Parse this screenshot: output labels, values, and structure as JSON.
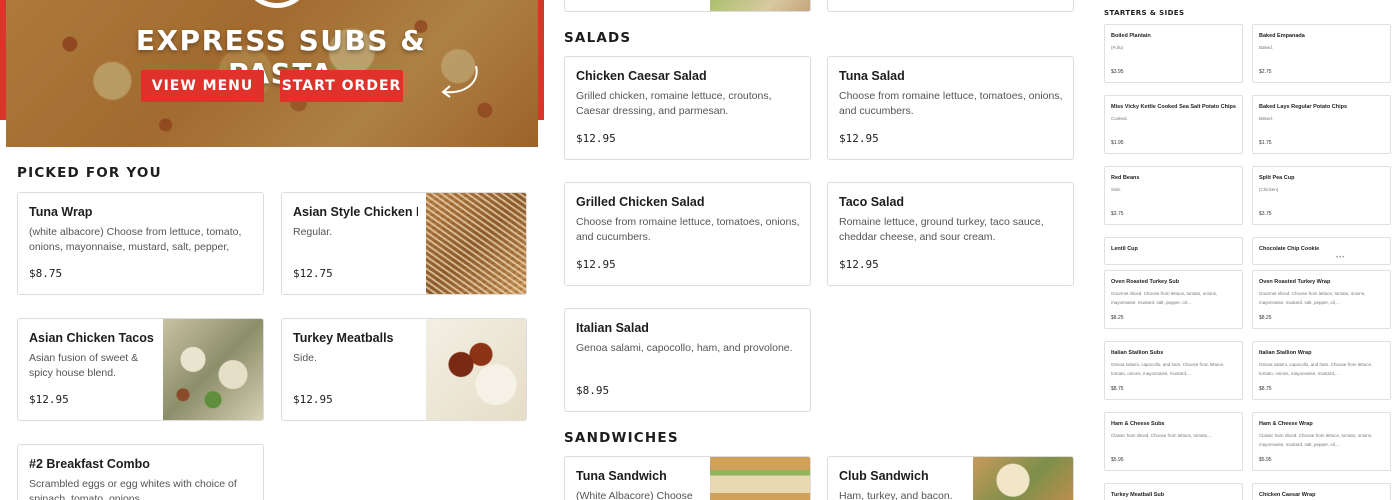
{
  "hero": {
    "title": "EXPRESS SUBS & PASTA",
    "view_menu": "VIEW MENU",
    "start_order": "START ORDER"
  },
  "sections": {
    "picked_for_you": "PICKED FOR YOU",
    "salads": "SALADS",
    "sandwiches": "SANDWICHES",
    "starters": "STARTERS & SIDES"
  },
  "picked": [
    {
      "name": "Tuna Wrap",
      "desc": "(white albacore) Choose from lettuce, tomato, onions, mayonnaise, mustard, salt, pepper, oil,...",
      "price": "$8.75"
    },
    {
      "name": "Asian Style Chicken Noodles",
      "desc": "Regular.",
      "price": "$12.75"
    },
    {
      "name": "Asian Chicken Tacos",
      "desc": "Asian fusion of sweet & spicy house blend.",
      "price": "$12.95"
    },
    {
      "name": "Turkey Meatballs",
      "desc": "Side.",
      "price": "$12.95"
    },
    {
      "name": "#2 Breakfast Combo",
      "desc": "Scrambled eggs or egg whites with choice of spinach, tomato, onions.",
      "price": ""
    }
  ],
  "salads": [
    {
      "name": "Chicken Caesar Salad",
      "desc": "Grilled chicken, romaine lettuce, croutons, Caesar dressing, and parmesan.",
      "price": "$12.95"
    },
    {
      "name": "Tuna Salad",
      "desc": "Choose from romaine lettuce, tomatoes, onions, and cucumbers.",
      "price": "$12.95"
    },
    {
      "name": "Grilled Chicken Salad",
      "desc": "Choose from romaine lettuce, tomatoes, onions, and cucumbers.",
      "price": "$12.95"
    },
    {
      "name": "Taco Salad",
      "desc": "Romaine lettuce, ground turkey, taco sauce, cheddar cheese, and sour cream.",
      "price": "$12.95"
    },
    {
      "name": "Italian Salad",
      "desc": "Genoa salami, capocollo, ham, and provolone.",
      "price": "$8.95"
    }
  ],
  "sandwiches": [
    {
      "name": "Tuna Sandwich",
      "desc": "(White Albacore) Choose"
    },
    {
      "name": "Club Sandwich",
      "desc": "Ham, turkey, and bacon."
    }
  ],
  "starters": [
    {
      "name": "Boiled Plantain",
      "desc": "(Fufu)",
      "price": "$3.95"
    },
    {
      "name": "Baked Empanada",
      "desc": "Baked.",
      "price": "$2.75"
    },
    {
      "name": "Miss Vicky Kettle Cooked Sea Salt Potato Chips",
      "desc": "Cooked.",
      "price": "$1.95"
    },
    {
      "name": "Baked Lays Regular Potato Chips",
      "desc": "Baked.",
      "price": "$1.75"
    },
    {
      "name": "Red Beans",
      "desc": "Side.",
      "price": "$3.75"
    },
    {
      "name": "Split Pea Cup",
      "desc": "(Chicken)",
      "price": "$3.75"
    },
    {
      "name": "Lentil Cup",
      "desc": "",
      "price": ""
    },
    {
      "name": "Chocolate Chip Cookie",
      "desc": "",
      "price": ""
    },
    {
      "name": "Oven Roasted Turkey Sub",
      "desc": "Gourmet sliced. Choose from lettuce, tomato, onions, mayonnaise, mustard, salt, pepper, oil,...",
      "price": "$8.25"
    },
    {
      "name": "Oven Roasted Turkey Wrap",
      "desc": "Gourmet sliced. Choose from lettuce, tomato, onions, mayonnaise, mustard, salt, pepper, oil,...",
      "price": "$8.25"
    },
    {
      "name": "Italian Stallion Subs",
      "desc": "Genoa salami, capocollo, and ham. Choose from lettuce, tomato, onions, mayonnaise, mustard,...",
      "price": "$8.75"
    },
    {
      "name": "Italian Stallion Wrap",
      "desc": "Genoa salami, capocollo, and ham. Choose from lettuce, tomato, onions, mayonnaise, mustard,...",
      "price": "$8.75"
    },
    {
      "name": "Ham & Cheese Subs",
      "desc": "Classic ham sliced. Choose from lettuce, tomato,...",
      "price": "$5.95"
    },
    {
      "name": "Ham & Cheese Wrap",
      "desc": "Classic ham sliced. Choose from lettuce, tomato, onions, mayonnaise, mustard, salt, pepper, oil,...",
      "price": "$5.95"
    },
    {
      "name": "Turkey Meatball Sub",
      "desc": "",
      "price": ""
    },
    {
      "name": "Chicken Caesar Wrap",
      "desc": "",
      "price": ""
    }
  ]
}
